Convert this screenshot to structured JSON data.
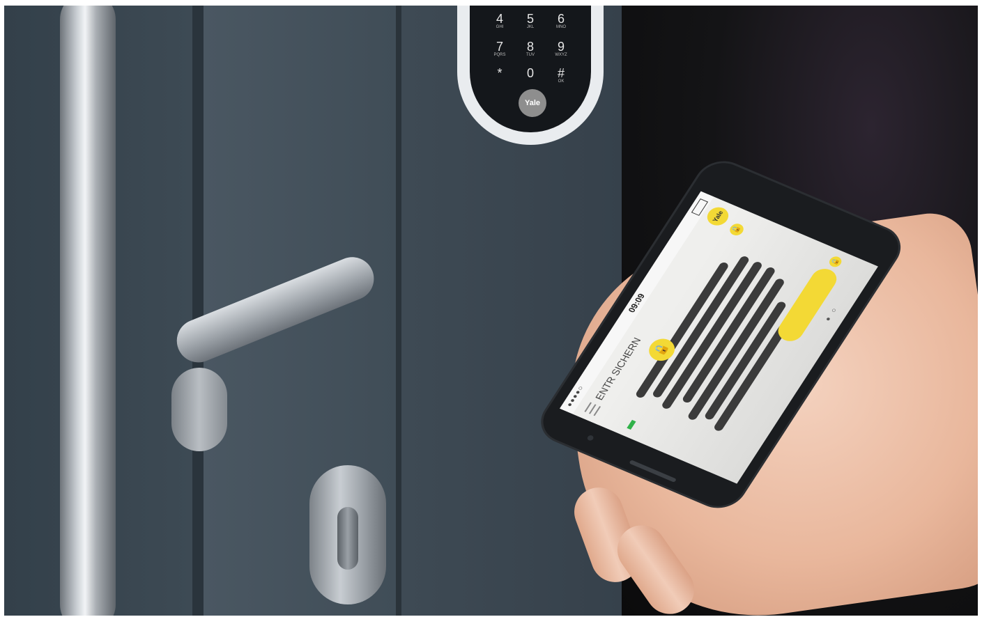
{
  "keypad": {
    "brand": "Yale",
    "keys": [
      {
        "digit": "4",
        "letters": "GHI"
      },
      {
        "digit": "5",
        "letters": "JKL"
      },
      {
        "digit": "6",
        "letters": "MNO"
      },
      {
        "digit": "7",
        "letters": "PQRS"
      },
      {
        "digit": "8",
        "letters": "TUV"
      },
      {
        "digit": "9",
        "letters": "WXYZ"
      },
      {
        "digit": "*",
        "letters": ""
      },
      {
        "digit": "0",
        "letters": ""
      },
      {
        "digit": "#",
        "letters": "OK"
      }
    ]
  },
  "phone": {
    "status_time": "09:09",
    "status_signal": "●●●●○",
    "screen_title": "ENTR SICHERN",
    "brand_logo": "Yale",
    "lock_icon": "lock-icon",
    "battery_color": "#31b24a",
    "accent_color": "#f3d935"
  }
}
